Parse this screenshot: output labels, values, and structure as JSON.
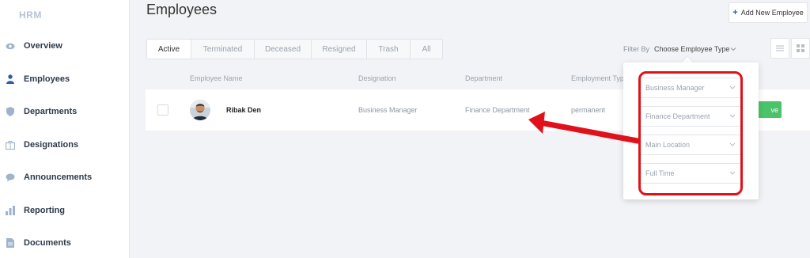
{
  "sidebar": {
    "brand": "HRM",
    "items": [
      {
        "label": "Overview",
        "icon": "eye-icon"
      },
      {
        "label": "Employees",
        "icon": "user-icon"
      },
      {
        "label": "Departments",
        "icon": "shield-icon"
      },
      {
        "label": "Designations",
        "icon": "briefcase-icon"
      },
      {
        "label": "Announcements",
        "icon": "chat-bubble-icon"
      },
      {
        "label": "Reporting",
        "icon": "bar-chart-icon"
      },
      {
        "label": "Documents",
        "icon": "document-icon"
      }
    ]
  },
  "header": {
    "title": "Employees",
    "add_button": "Add New Employee"
  },
  "tabs": [
    "Active",
    "Terminated",
    "Deceased",
    "Resigned",
    "Trash",
    "All"
  ],
  "filter": {
    "label": "Filter By",
    "value": "Choose Employee Type",
    "options": [
      "Business Manager",
      "Finance Department",
      "Main Location",
      "Full Time"
    ]
  },
  "table": {
    "columns": [
      "Employee Name",
      "Designation",
      "Department",
      "Employment Typ"
    ],
    "rows": [
      {
        "name": "Ribak Den",
        "designation": "Business Manager",
        "department": "Finance Department",
        "employment_type": "permanent",
        "status": "ve"
      }
    ]
  },
  "colors": {
    "accent": "#2f5aa8",
    "highlight": "#e1111b",
    "status_active": "#4cc26a"
  }
}
